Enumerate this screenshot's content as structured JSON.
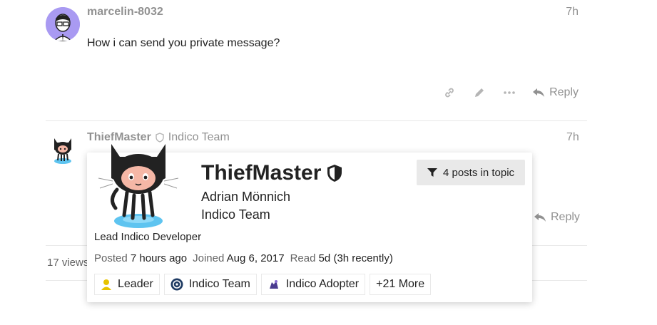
{
  "post1": {
    "username": "marcelin-8032",
    "time": "7h",
    "body": "How i can send you private message?",
    "reply_label": "Reply",
    "avatar_color": "#a99af2"
  },
  "post2": {
    "username": "ThiefMaster",
    "group": "Indico Team",
    "time": "7h",
    "reply_label": "Reply"
  },
  "topic_footer": {
    "views": "17 views"
  },
  "user_card": {
    "username": "ThiefMaster",
    "real_name": "Adrian Mönnich",
    "group": "Indico Team",
    "filter_button": "4 posts in topic",
    "bio": "Lead Indico Developer",
    "meta": {
      "posted_label": "Posted",
      "posted_value": "7 hours ago",
      "joined_label": "Joined",
      "joined_value": "Aug 6, 2017",
      "read_label": "Read",
      "read_value": "5d (3h recently)"
    },
    "badges": [
      {
        "label": "Leader",
        "icon": "person-icon"
      },
      {
        "label": "Indico Team",
        "icon": "indico-logo-icon"
      },
      {
        "label": "Indico Adopter",
        "icon": "adopter-icon"
      },
      {
        "label": "+21 More",
        "icon": ""
      }
    ]
  },
  "colors": {
    "muted": "#919191",
    "border": "#e9e9e9",
    "button_bg": "#e9e9e9"
  }
}
